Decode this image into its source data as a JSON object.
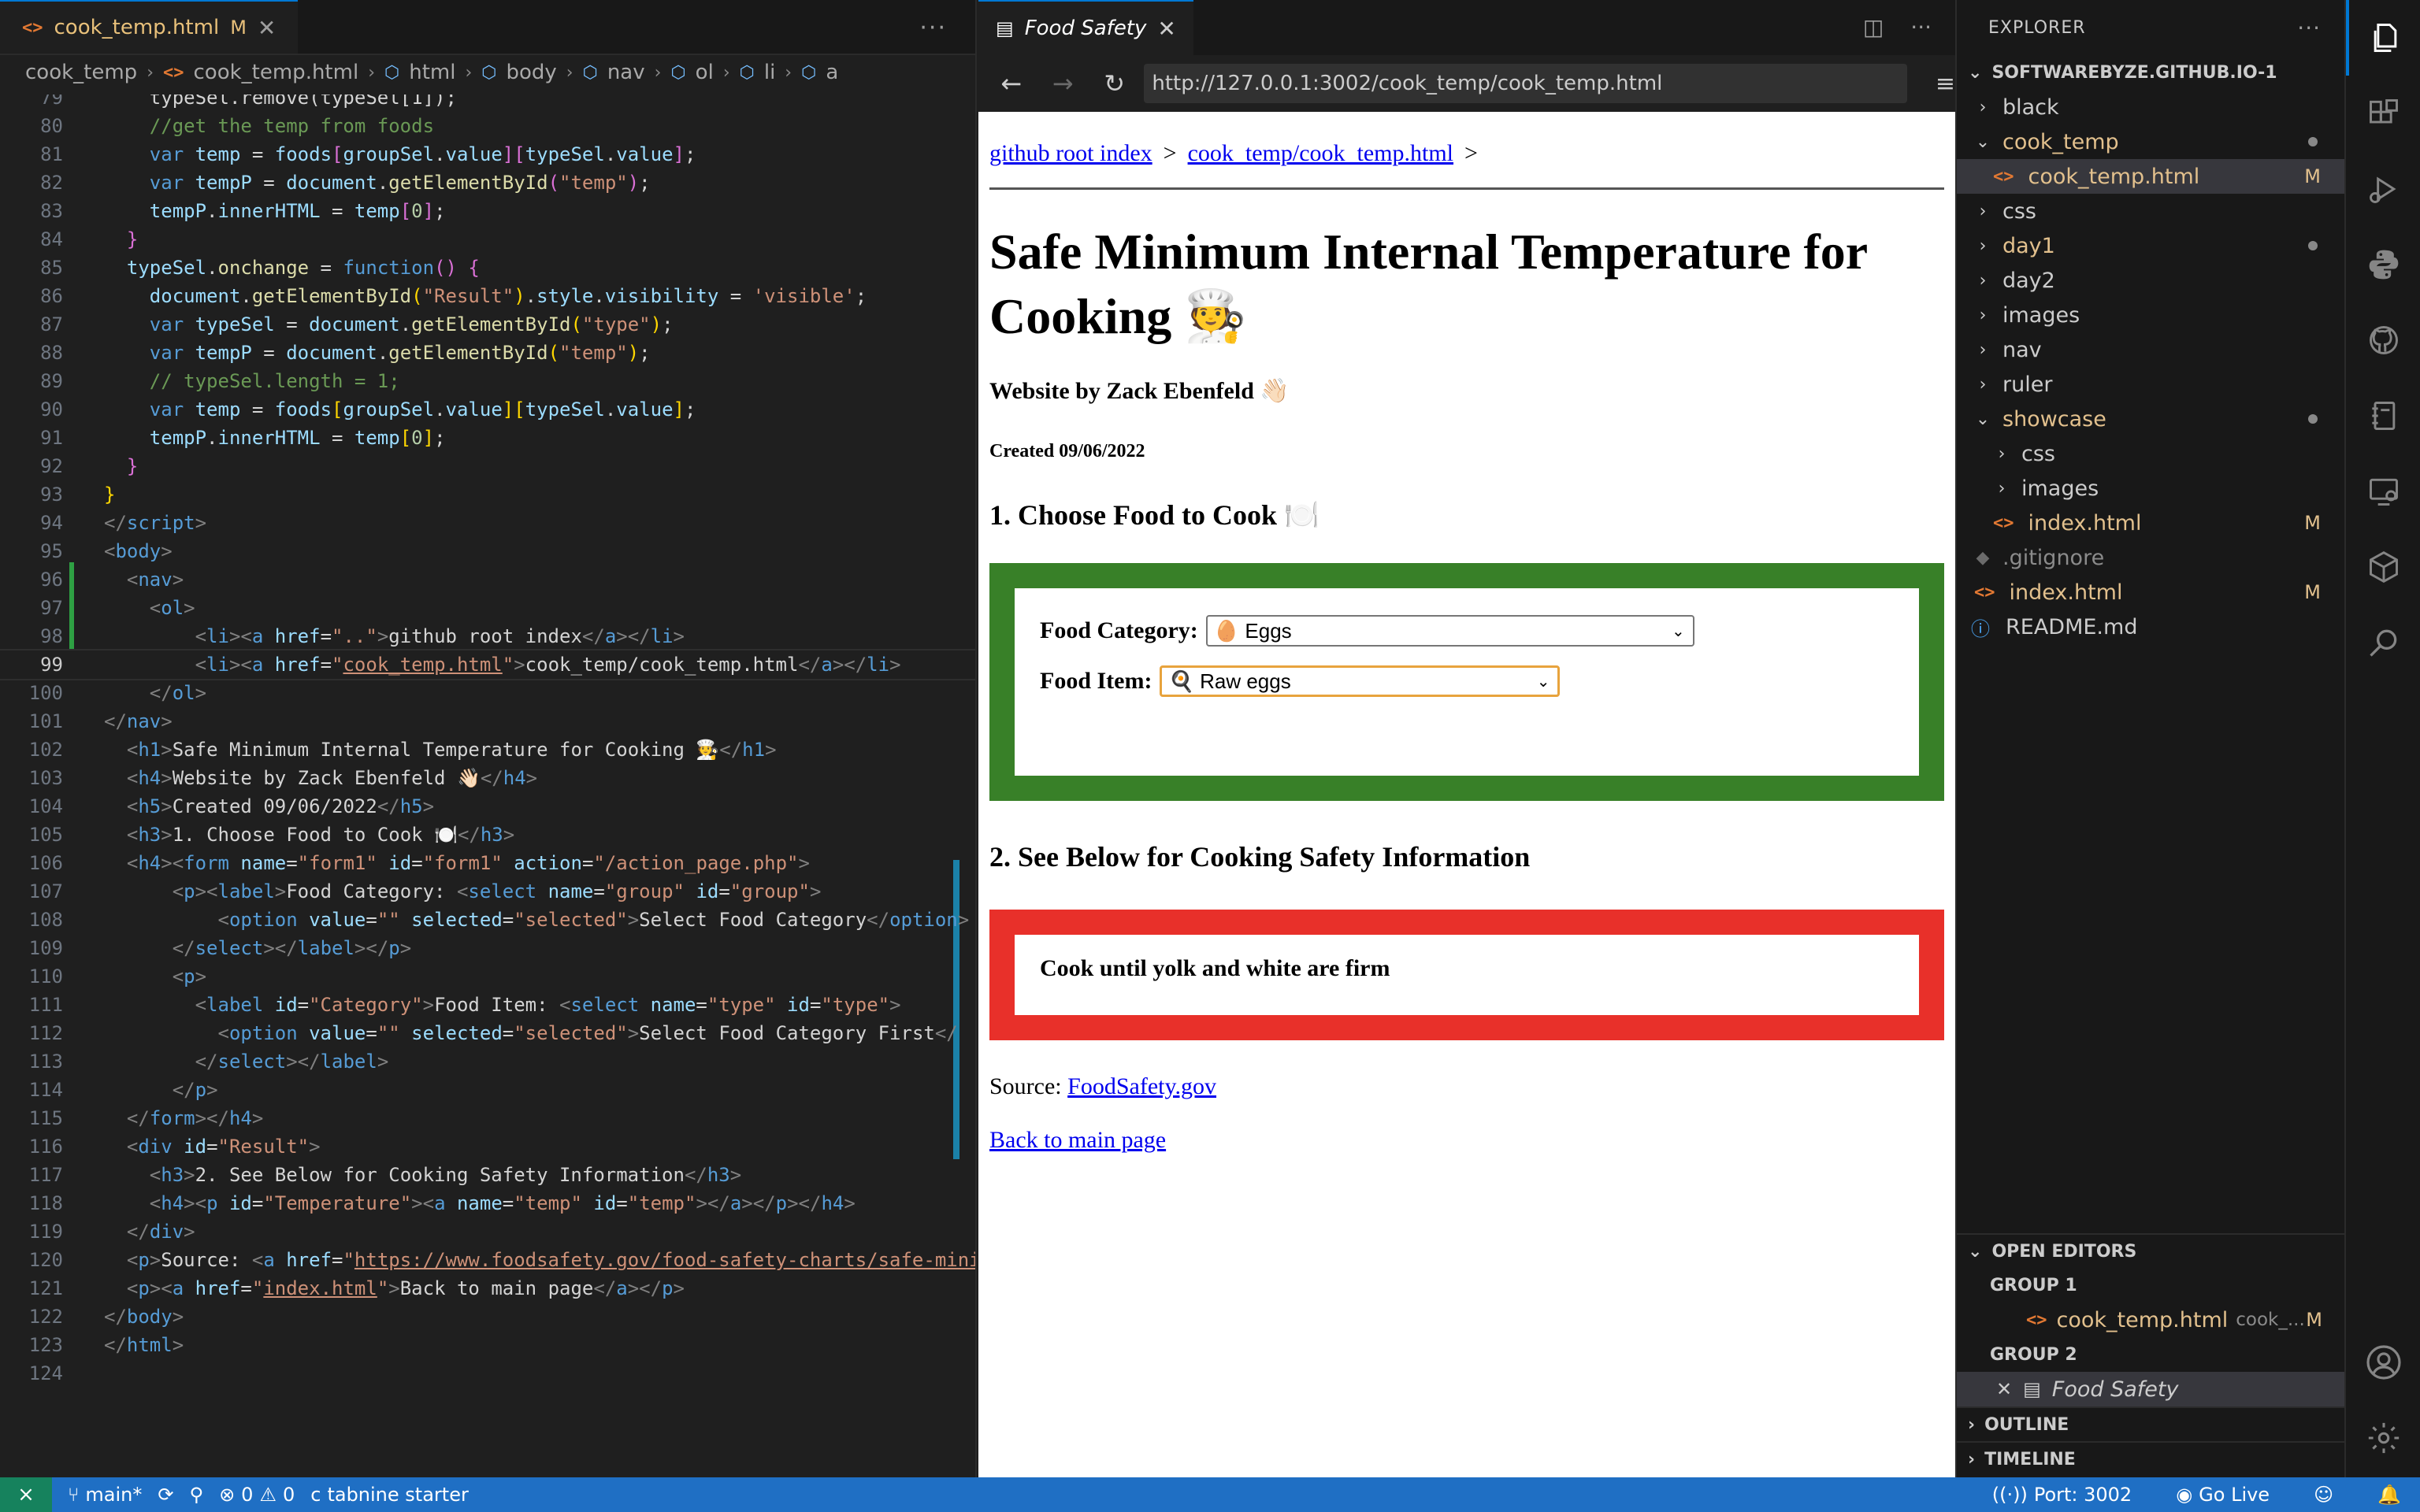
{
  "editor": {
    "tab": {
      "filename": "cook_temp.html",
      "modified": "M"
    },
    "breadcrumb": [
      "cook_temp",
      "cook_temp.html",
      "html",
      "body",
      "nav",
      "ol",
      "li",
      "a"
    ],
    "active_line": "99"
  },
  "code_lines": [
    {
      "n": "79",
      "h": "<span class=\"tx\">    typeSel.remove(typeSel[1]);</span>"
    },
    {
      "n": "80",
      "h": "    <span class=\"cm\">//get the temp from foods</span>"
    },
    {
      "n": "81",
      "h": "    <span class=\"kw\">var</span> <span class=\"vr\">temp</span> = <span class=\"vr\">foods</span><span class=\"br2\">[</span><span class=\"vr\">groupSel</span>.<span class=\"vr\">value</span><span class=\"br2\">]</span><span class=\"br2\">[</span><span class=\"vr\">typeSel</span>.<span class=\"vr\">value</span><span class=\"br2\">]</span>;"
    },
    {
      "n": "82",
      "h": "    <span class=\"kw\">var</span> <span class=\"vr\">tempP</span> = <span class=\"vr\">document</span>.<span class=\"fn\">getElementById</span><span class=\"br2\">(</span><span class=\"st\">\"temp\"</span><span class=\"br2\">)</span>;"
    },
    {
      "n": "83",
      "h": "    <span class=\"vr\">tempP</span>.<span class=\"vr\">innerHTML</span> = <span class=\"vr\">temp</span><span class=\"br2\">[</span><span class=\"nm\">0</span><span class=\"br2\">]</span>;"
    },
    {
      "n": "84",
      "h": "  <span class=\"br2\">}</span>"
    },
    {
      "n": "85",
      "h": "  <span class=\"vr\">typeSel</span>.<span class=\"fn\">onchange</span> = <span class=\"kw\">function</span><span class=\"br2\">()</span> <span class=\"br2\">{</span>"
    },
    {
      "n": "86",
      "h": "    <span class=\"vr\">document</span>.<span class=\"fn\">getElementById</span><span class=\"br1\">(</span><span class=\"st\">\"Result\"</span><span class=\"br1\">)</span>.<span class=\"vr\">style</span>.<span class=\"vr\">visibility</span> = <span class=\"st\">'visible'</span>;"
    },
    {
      "n": "87",
      "h": "    <span class=\"kw\">var</span> <span class=\"vr\">typeSel</span> = <span class=\"vr\">document</span>.<span class=\"fn\">getElementById</span><span class=\"br1\">(</span><span class=\"st\">\"type\"</span><span class=\"br1\">)</span>;"
    },
    {
      "n": "88",
      "h": "    <span class=\"kw\">var</span> <span class=\"vr\">tempP</span> = <span class=\"vr\">document</span>.<span class=\"fn\">getElementById</span><span class=\"br1\">(</span><span class=\"st\">\"temp\"</span><span class=\"br1\">)</span>;"
    },
    {
      "n": "89",
      "h": "    <span class=\"cm\">// typeSel.length = 1;</span>"
    },
    {
      "n": "90",
      "h": "    <span class=\"kw\">var</span> <span class=\"vr\">temp</span> = <span class=\"vr\">foods</span><span class=\"br1\">[</span><span class=\"vr\">groupSel</span>.<span class=\"vr\">value</span><span class=\"br1\">]</span><span class=\"br1\">[</span><span class=\"vr\">typeSel</span>.<span class=\"vr\">value</span><span class=\"br1\">]</span>;"
    },
    {
      "n": "91",
      "h": "    <span class=\"vr\">tempP</span>.<span class=\"vr\">innerHTML</span> = <span class=\"vr\">temp</span><span class=\"br1\">[</span><span class=\"nm\">0</span><span class=\"br1\">]</span>;"
    },
    {
      "n": "92",
      "h": "  <span class=\"br2\">}</span>"
    },
    {
      "n": "93",
      "h": "<span class=\"br1\">}</span>"
    },
    {
      "n": "94",
      "h": "<span class=\"tg\">&lt;/</span><span class=\"tn\">script</span><span class=\"tg\">&gt;</span>"
    },
    {
      "n": "95",
      "h": "<span class=\"tg\">&lt;</span><span class=\"tn\">body</span><span class=\"tg\">&gt;</span>"
    },
    {
      "n": "96",
      "h": "  <span class=\"tg\">&lt;</span><span class=\"tn\">nav</span><span class=\"tg\">&gt;</span>"
    },
    {
      "n": "97",
      "h": "    <span class=\"tg\">&lt;</span><span class=\"tn\">ol</span><span class=\"tg\">&gt;</span>"
    },
    {
      "n": "98",
      "h": "        <span class=\"tg\">&lt;</span><span class=\"tn\">li</span><span class=\"tg\">&gt;&lt;</span><span class=\"tn\">a</span> <span class=\"at\">href</span>=<span class=\"st\">\"..\"</span><span class=\"tg\">&gt;</span>github root index<span class=\"tg\">&lt;/</span><span class=\"tn\">a</span><span class=\"tg\">&gt;&lt;/</span><span class=\"tn\">li</span><span class=\"tg\">&gt;</span>"
    },
    {
      "n": "99",
      "h": "        <span class=\"tg\">&lt;</span><span class=\"tn\">li</span><span class=\"tg\">&gt;&lt;</span><span class=\"tn\">a</span> <span class=\"at\">href</span>=<span class=\"st\">\"<span class=\"ul\">cook_temp.html</span>\"</span><span class=\"tg\">&gt;</span>cook_temp/cook_temp.html<span class=\"tg\">&lt;/</span><span class=\"tn\">a</span><span class=\"tg\">&gt;&lt;/</span><span class=\"tn\">li</span><span class=\"tg\">&gt;</span>"
    },
    {
      "n": "100",
      "h": "    <span class=\"tg\">&lt;/</span><span class=\"tn\">ol</span><span class=\"tg\">&gt;</span>"
    },
    {
      "n": "101",
      "h": "<span class=\"tg\">&lt;/</span><span class=\"tn\">nav</span><span class=\"tg\">&gt;</span>"
    },
    {
      "n": "102",
      "h": "  <span class=\"tg\">&lt;</span><span class=\"tn\">h1</span><span class=\"tg\">&gt;</span>Safe Minimum Internal Temperature for Cooking 🧑‍🍳<span class=\"tg\">&lt;/</span><span class=\"tn\">h1</span><span class=\"tg\">&gt;</span>"
    },
    {
      "n": "103",
      "h": "  <span class=\"tg\">&lt;</span><span class=\"tn\">h4</span><span class=\"tg\">&gt;</span>Website by Zack Ebenfeld 👋🏻<span class=\"tg\">&lt;/</span><span class=\"tn\">h4</span><span class=\"tg\">&gt;</span>"
    },
    {
      "n": "104",
      "h": "  <span class=\"tg\">&lt;</span><span class=\"tn\">h5</span><span class=\"tg\">&gt;</span>Created 09/06/2022<span class=\"tg\">&lt;/</span><span class=\"tn\">h5</span><span class=\"tg\">&gt;</span>"
    },
    {
      "n": "105",
      "h": "  <span class=\"tg\">&lt;</span><span class=\"tn\">h3</span><span class=\"tg\">&gt;</span>1. Choose Food to Cook 🍽️<span class=\"tg\">&lt;/</span><span class=\"tn\">h3</span><span class=\"tg\">&gt;</span>"
    },
    {
      "n": "106",
      "h": "  <span class=\"tg\">&lt;</span><span class=\"tn\">h4</span><span class=\"tg\">&gt;&lt;</span><span class=\"tn\">form</span> <span class=\"at\">name</span>=<span class=\"st\">\"form1\"</span> <span class=\"at\">id</span>=<span class=\"st\">\"form1\"</span> <span class=\"at\">action</span>=<span class=\"st\">\"/action_page.php\"</span><span class=\"tg\">&gt;</span>"
    },
    {
      "n": "107",
      "h": "      <span class=\"tg\">&lt;</span><span class=\"tn\">p</span><span class=\"tg\">&gt;&lt;</span><span class=\"tn\">label</span><span class=\"tg\">&gt;</span>Food Category: <span class=\"tg\">&lt;</span><span class=\"tn\">select</span> <span class=\"at\">name</span>=<span class=\"st\">\"group\"</span> <span class=\"at\">id</span>=<span class=\"st\">\"group\"</span><span class=\"tg\">&gt;</span>"
    },
    {
      "n": "108",
      "h": "          <span class=\"tg\">&lt;</span><span class=\"tn\">option</span> <span class=\"at\">value</span>=<span class=\"st\">\"\"</span> <span class=\"at\">selected</span>=<span class=\"st\">\"selected\"</span><span class=\"tg\">&gt;</span>Select Food Category<span class=\"tg\">&lt;/</span><span class=\"tn\">option</span><span class=\"tg\">&gt;</span>"
    },
    {
      "n": "109",
      "h": "      <span class=\"tg\">&lt;/</span><span class=\"tn\">select</span><span class=\"tg\">&gt;&lt;/</span><span class=\"tn\">label</span><span class=\"tg\">&gt;&lt;/</span><span class=\"tn\">p</span><span class=\"tg\">&gt;</span>"
    },
    {
      "n": "110",
      "h": "      <span class=\"tg\">&lt;</span><span class=\"tn\">p</span><span class=\"tg\">&gt;</span>"
    },
    {
      "n": "111",
      "h": "        <span class=\"tg\">&lt;</span><span class=\"tn\">label</span> <span class=\"at\">id</span>=<span class=\"st\">\"Category\"</span><span class=\"tg\">&gt;</span>Food Item: <span class=\"tg\">&lt;</span><span class=\"tn\">select</span> <span class=\"at\">name</span>=<span class=\"st\">\"type\"</span> <span class=\"at\">id</span>=<span class=\"st\">\"type\"</span><span class=\"tg\">&gt;</span>"
    },
    {
      "n": "112",
      "h": "          <span class=\"tg\">&lt;</span><span class=\"tn\">option</span> <span class=\"at\">value</span>=<span class=\"st\">\"\"</span> <span class=\"at\">selected</span>=<span class=\"st\">\"selected\"</span><span class=\"tg\">&gt;</span>Select Food Category First<span class=\"tg\">&lt;/</span>"
    },
    {
      "n": "113",
      "h": "        <span class=\"tg\">&lt;/</span><span class=\"tn\">select</span><span class=\"tg\">&gt;&lt;/</span><span class=\"tn\">label</span><span class=\"tg\">&gt;</span>"
    },
    {
      "n": "114",
      "h": "      <span class=\"tg\">&lt;/</span><span class=\"tn\">p</span><span class=\"tg\">&gt;</span>"
    },
    {
      "n": "115",
      "h": "  <span class=\"tg\">&lt;/</span><span class=\"tn\">form</span><span class=\"tg\">&gt;&lt;/</span><span class=\"tn\">h4</span><span class=\"tg\">&gt;</span>"
    },
    {
      "n": "116",
      "h": "  <span class=\"tg\">&lt;</span><span class=\"tn\">div</span> <span class=\"at\">id</span>=<span class=\"st\">\"Result\"</span><span class=\"tg\">&gt;</span>"
    },
    {
      "n": "117",
      "h": "    <span class=\"tg\">&lt;</span><span class=\"tn\">h3</span><span class=\"tg\">&gt;</span>2. See Below for Cooking Safety Information<span class=\"tg\">&lt;/</span><span class=\"tn\">h3</span><span class=\"tg\">&gt;</span>"
    },
    {
      "n": "118",
      "h": "    <span class=\"tg\">&lt;</span><span class=\"tn\">h4</span><span class=\"tg\">&gt;&lt;</span><span class=\"tn\">p</span> <span class=\"at\">id</span>=<span class=\"st\">\"Temperature\"</span><span class=\"tg\">&gt;&lt;</span><span class=\"tn\">a</span> <span class=\"at\">name</span>=<span class=\"st\">\"temp\"</span> <span class=\"at\">id</span>=<span class=\"st\">\"temp\"</span><span class=\"tg\">&gt;&lt;/</span><span class=\"tn\">a</span><span class=\"tg\">&gt;&lt;/</span><span class=\"tn\">p</span><span class=\"tg\">&gt;&lt;/</span><span class=\"tn\">h4</span><span class=\"tg\">&gt;</span>"
    },
    {
      "n": "119",
      "h": "  <span class=\"tg\">&lt;/</span><span class=\"tn\">div</span><span class=\"tg\">&gt;</span>"
    },
    {
      "n": "120",
      "h": "  <span class=\"tg\">&lt;</span><span class=\"tn\">p</span><span class=\"tg\">&gt;</span>Source: <span class=\"tg\">&lt;</span><span class=\"tn\">a</span> <span class=\"at\">href</span>=<span class=\"st\">\"<span class=\"ul\">https://www.foodsafety.gov/food-safety-charts/safe-mini</span></span>"
    },
    {
      "n": "121",
      "h": "  <span class=\"tg\">&lt;</span><span class=\"tn\">p</span><span class=\"tg\">&gt;&lt;</span><span class=\"tn\">a</span> <span class=\"at\">href</span>=<span class=\"st\">\"<span class=\"ul\">index.html</span>\"</span><span class=\"tg\">&gt;</span>Back to main page<span class=\"tg\">&lt;/</span><span class=\"tn\">a</span><span class=\"tg\">&gt;&lt;/</span><span class=\"tn\">p</span><span class=\"tg\">&gt;</span>"
    },
    {
      "n": "122",
      "h": "<span class=\"tg\">&lt;/</span><span class=\"tn\">body</span><span class=\"tg\">&gt;</span>"
    },
    {
      "n": "123",
      "h": "<span class=\"tg\">&lt;/</span><span class=\"tn\">html</span><span class=\"tg\">&gt;</span>"
    },
    {
      "n": "124",
      "h": ""
    }
  ],
  "preview": {
    "tab_title": "Food Safety",
    "url": "http://127.0.0.1:3002/cook_temp/cook_temp.html",
    "crumb1": "github root index",
    "crumb2": "cook_temp/cook_temp.html",
    "crumb_sep": ">",
    "h1": "Safe Minimum Internal Temperature for Cooking 🧑‍🍳",
    "author": "Website by Zack Ebenfeld 👋🏻",
    "created": "Created 09/06/2022",
    "step1": "1. Choose Food to Cook 🍽️",
    "category_label": "Food Category:",
    "category_value": "🥚 Eggs",
    "item_label": "Food Item:",
    "item_value": "🍳 Raw eggs",
    "step2": "2. See Below for Cooking Safety Information",
    "result": "Cook until yolk and white are firm",
    "source_label": "Source:",
    "source_link": "FoodSafety.gov",
    "back_link": "Back to main page",
    "colors": {
      "green_box": "#388028",
      "red_box": "#e8302a"
    }
  },
  "explorer": {
    "title": "EXPLORER",
    "root": "SOFTWAREBYZE.GITHUB.IO-1",
    "open_editors": "OPEN EDITORS",
    "group1": "GROUP 1",
    "group1_file": "cook_temp.html",
    "group1_path": "cook_...",
    "group1_badge": "M",
    "group2": "GROUP 2",
    "group2_file": "Food Safety",
    "outline": "OUTLINE",
    "timeline": "TIMELINE"
  },
  "tree": [
    {
      "label": "black",
      "chev": "›",
      "indent": 0,
      "cls": ""
    },
    {
      "label": "cook_temp",
      "chev": "⌄",
      "indent": 0,
      "cls": "mod",
      "dot": true
    },
    {
      "label": "cook_temp.html",
      "chev": "",
      "indent": 1,
      "cls": "mod",
      "badge": "M",
      "sel": true,
      "file": true
    },
    {
      "label": "css",
      "chev": "›",
      "indent": 0,
      "cls": ""
    },
    {
      "label": "day1",
      "chev": "›",
      "indent": 0,
      "cls": "mod",
      "dot": true
    },
    {
      "label": "day2",
      "chev": "›",
      "indent": 0,
      "cls": ""
    },
    {
      "label": "images",
      "chev": "›",
      "indent": 0,
      "cls": ""
    },
    {
      "label": "nav",
      "chev": "›",
      "indent": 0,
      "cls": ""
    },
    {
      "label": "ruler",
      "chev": "›",
      "indent": 0,
      "cls": ""
    },
    {
      "label": "showcase",
      "chev": "⌄",
      "indent": 0,
      "cls": "mod",
      "dot": true
    },
    {
      "label": "css",
      "chev": "›",
      "indent": 1,
      "cls": ""
    },
    {
      "label": "images",
      "chev": "›",
      "indent": 1,
      "cls": ""
    },
    {
      "label": "index.html",
      "chev": "",
      "indent": 1,
      "cls": "mod",
      "badge": "M",
      "file": true
    },
    {
      "label": ".gitignore",
      "chev": "",
      "indent": 0,
      "cls": "gitignore",
      "file": "git"
    },
    {
      "label": "index.html",
      "chev": "",
      "indent": 0,
      "cls": "mod",
      "badge": "M",
      "file": true
    },
    {
      "label": "README.md",
      "chev": "",
      "indent": 0,
      "cls": "",
      "file": "info"
    }
  ],
  "status": {
    "branch": "main*",
    "errors": "0",
    "warnings": "0",
    "tabnine": "tabnine starter",
    "port": "Port: 3002",
    "golive": "Go Live"
  }
}
